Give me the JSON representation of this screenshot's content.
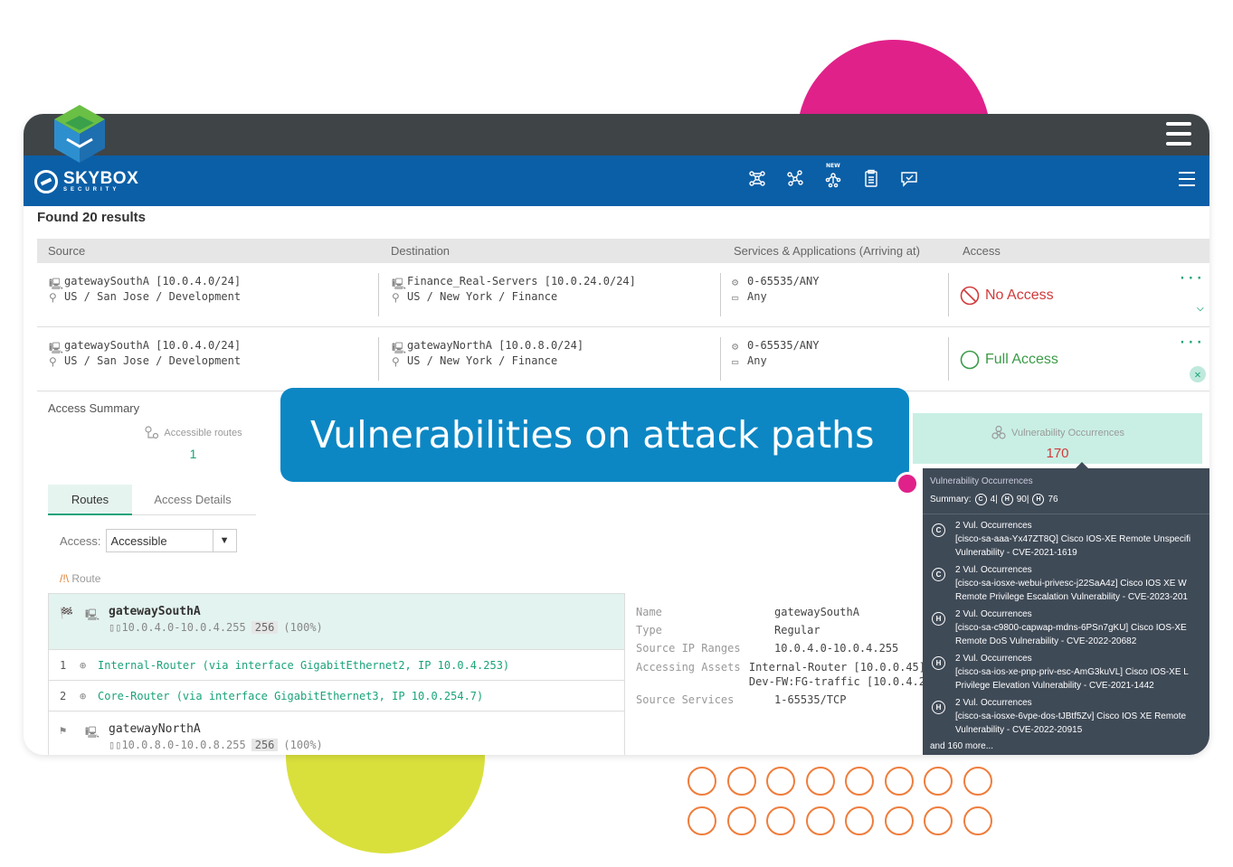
{
  "header": {
    "brand_name": "SKYBOX",
    "brand_sub": "SECURITY",
    "nav_icons": [
      "network-map-icon",
      "attack-path-icon",
      "new-topology-icon",
      "clipboard-icon",
      "chat-icon"
    ],
    "new_badge": "NEW"
  },
  "results": {
    "title": "Found 20 results",
    "columns": [
      "Source",
      "Destination",
      "Services & Applications (Arriving at)",
      "Access"
    ],
    "rows": [
      {
        "source_name": "gatewaySouthA [10.0.4.0/24]",
        "source_loc": "US / San Jose / Development",
        "dest_name": "Finance_Real-Servers [10.0.24.0/24]",
        "dest_loc": "US / New York / Finance",
        "service": "0-65535/ANY",
        "app": "Any",
        "access": "No Access",
        "more": "···"
      },
      {
        "source_name": "gatewaySouthA [10.0.4.0/24]",
        "source_loc": "US / San Jose / Development",
        "dest_name": "gatewayNorthA [10.0.8.0/24]",
        "dest_loc": "US / New York / Finance",
        "service": "0-65535/ANY",
        "app": "Any",
        "access": "Full Access",
        "more": "···"
      }
    ]
  },
  "summary": {
    "label": "Access Summary",
    "accessible_routes_label": "Accessible routes",
    "accessible_routes_value": "1",
    "vuln_label": "Vulnerability Occurrences",
    "vuln_value": "170"
  },
  "callout": "Vulnerabilities on attack paths",
  "tabs": [
    "Routes",
    "Access Details"
  ],
  "access_filter": {
    "label": "Access:",
    "value": "Accessible"
  },
  "route_head": {
    "icon": "/!\\",
    "label": "Route"
  },
  "route": {
    "source": {
      "name": "gatewaySouthA",
      "range": "10.0.4.0-10.0.4.255",
      "count": "256",
      "pct": "(100%)"
    },
    "hops": [
      {
        "num": "1",
        "text": "Internal-Router (via interface GigabitEthernet2, IP 10.0.4.253)"
      },
      {
        "num": "2",
        "text": "Core-Router (via interface GigabitEthernet3, IP 10.0.254.7)"
      }
    ],
    "dest": {
      "name": "gatewayNorthA",
      "range": "10.0.8.0-10.0.8.255",
      "count": "256",
      "pct": "(100%)"
    }
  },
  "details": {
    "name_key": "Name",
    "name_val": "gatewaySouthA",
    "type_key": "Type",
    "type_val": "Regular",
    "ranges_key": "Source IP Ranges",
    "ranges_val": "10.0.4.0-10.0.4.255",
    "assets_key": "Accessing Assets",
    "assets_val1": "Internal-Router [10.0.0.45]",
    "assets_val2": "Dev-FW:FG-traffic [10.0.4.2",
    "services_key": "Source Services",
    "services_val": "1-65535/TCP"
  },
  "vuln_popup": {
    "title": "Vulnerability Occurrences",
    "summary_label": "Summary:",
    "sev_c": "C",
    "count_c": "4|",
    "sev_h1": "H",
    "count_h1": "90|",
    "sev_h2": "H",
    "count_h2": "76",
    "items": [
      {
        "sev": "C",
        "count": "2 Vul. Occurrences",
        "line1": "[cisco-sa-aaa-Yx47ZT8Q] Cisco IOS-XE Remote Unspecifi",
        "line2": "Vulnerability - CVE-2021-1619"
      },
      {
        "sev": "C",
        "count": "2 Vul. Occurrences",
        "line1": "[cisco-sa-iosxe-webui-privesc-j22SaA4z] Cisco IOS XE W",
        "line2": "Remote Privilege Escalation Vulnerability - CVE-2023-201"
      },
      {
        "sev": "H",
        "count": "2 Vul. Occurrences",
        "line1": "[cisco-sa-c9800-capwap-mdns-6PSn7gKU] Cisco IOS-XE",
        "line2": "Remote DoS Vulnerability - CVE-2022-20682"
      },
      {
        "sev": "H",
        "count": "2 Vul. Occurrences",
        "line1": "[cisco-sa-ios-xe-pnp-priv-esc-AmG3kuVL] Cisco IOS-XE L",
        "line2": "Privilege Elevation Vulnerability - CVE-2021-1442"
      },
      {
        "sev": "H",
        "count": "2 Vul. Occurrences",
        "line1": "[cisco-sa-iosxe-6vpe-dos-tJBtf5Zv] Cisco IOS XE Remote",
        "line2": "Vulnerability - CVE-2022-20915"
      }
    ],
    "more": "and 160 more..."
  },
  "colors": {
    "titlebar": "#3f4447",
    "navbar": "#0b5fa7",
    "accent_green": "#1aa37a",
    "no_access_red": "#d23a3a",
    "callout_blue": "#0c87c4",
    "pink": "#e0218a",
    "lime": "#d9e03c",
    "ring_orange": "#ef7d3c"
  }
}
